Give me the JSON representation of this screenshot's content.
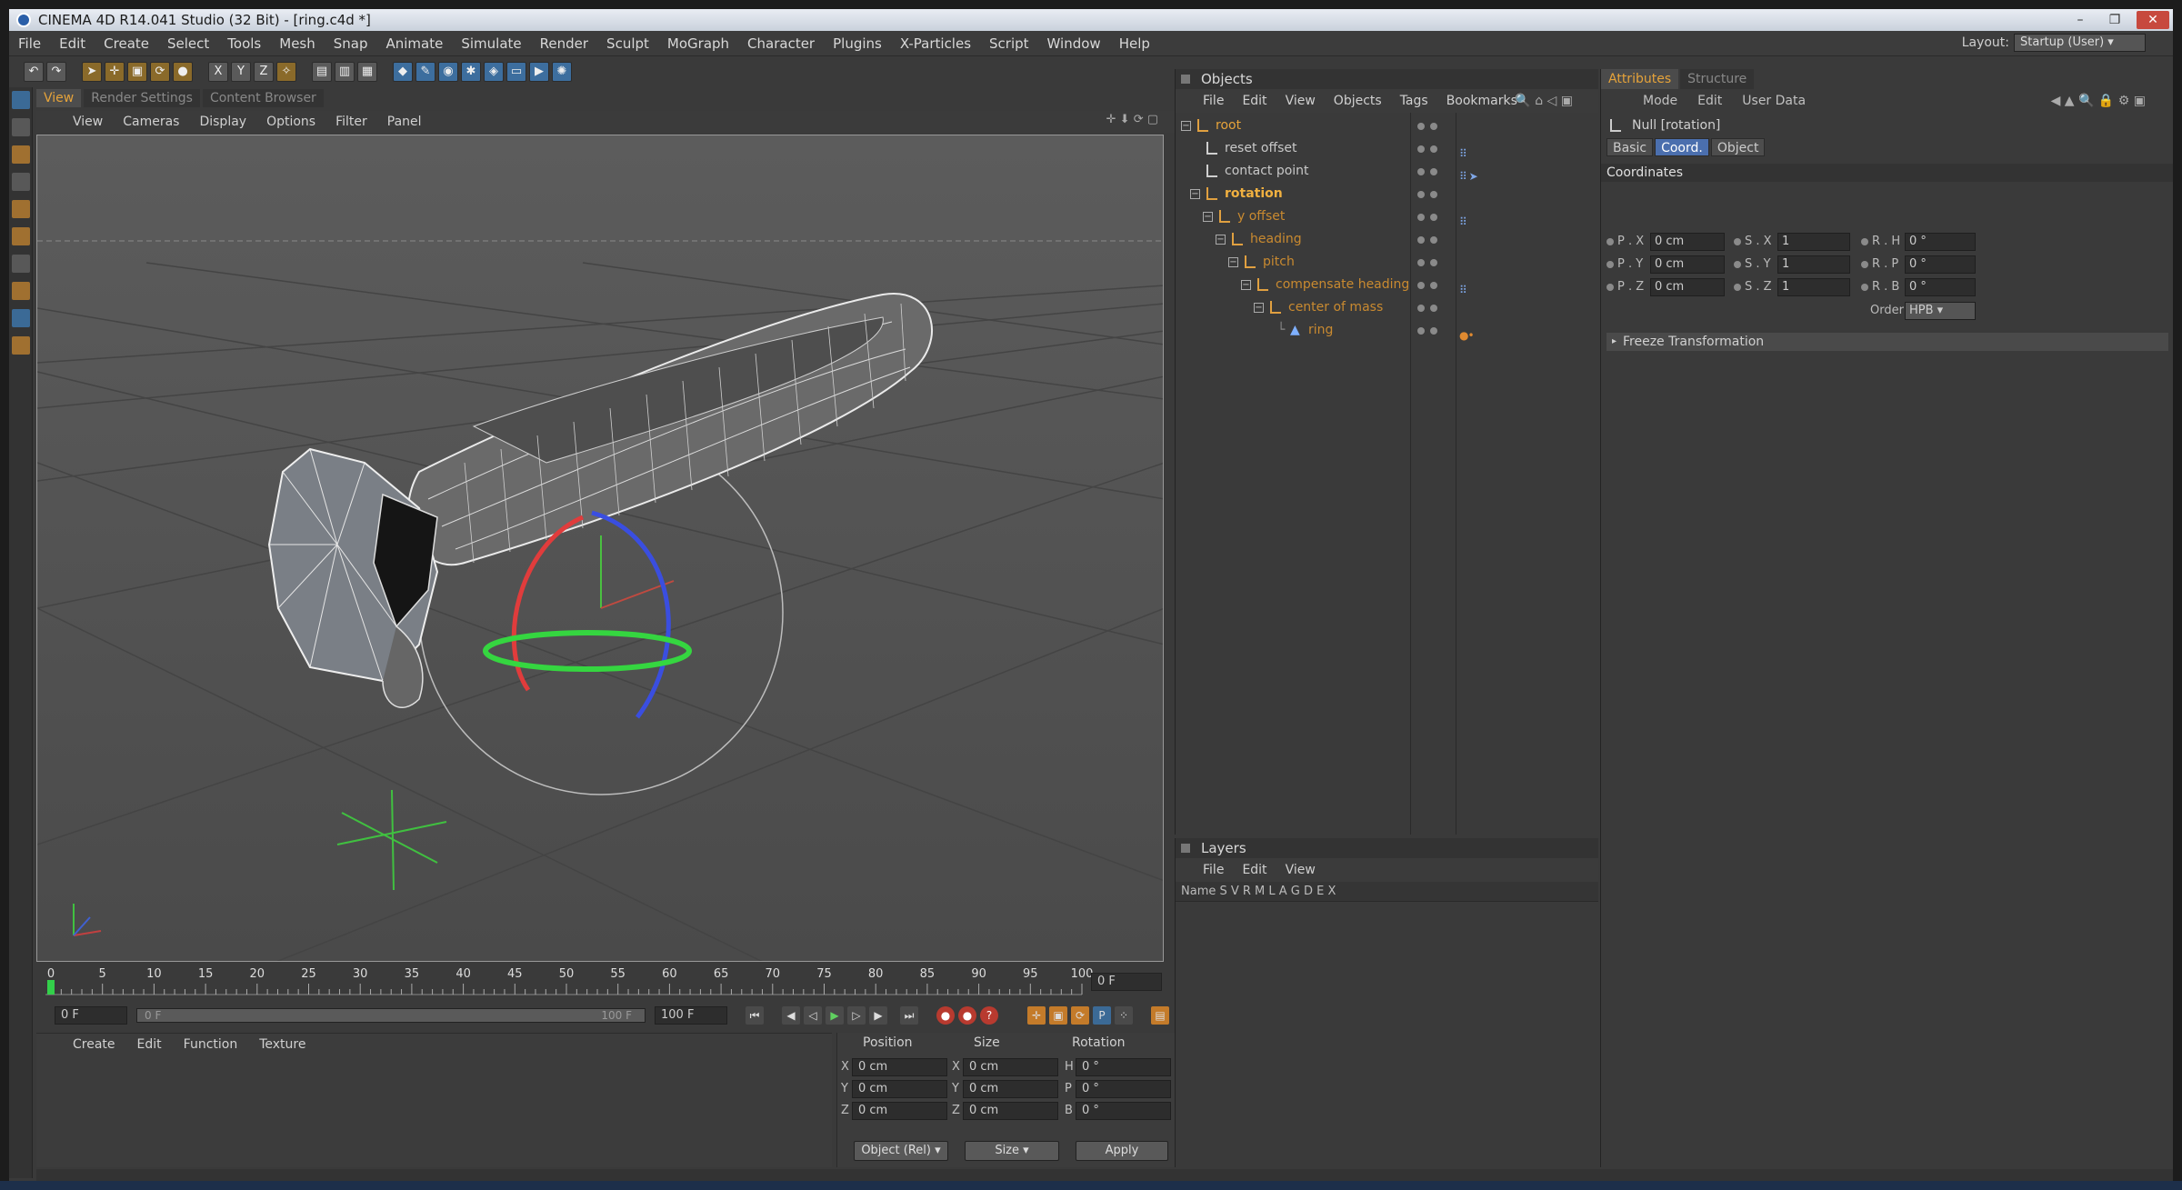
{
  "window": {
    "title": "CINEMA 4D R14.041 Studio (32 Bit) - [ring.c4d *]",
    "controls": [
      "–",
      "❐",
      "✕"
    ]
  },
  "menubar": {
    "items": [
      "File",
      "Edit",
      "Create",
      "Select",
      "Tools",
      "Mesh",
      "Snap",
      "Animate",
      "Simulate",
      "Render",
      "Sculpt",
      "MoGraph",
      "Character",
      "Plugins",
      "X-Particles",
      "Script",
      "Window",
      "Help"
    ],
    "layout_label": "Layout:",
    "layout_value": "Startup (User)"
  },
  "viewport": {
    "tabs": [
      "View",
      "Render Settings",
      "Content Browser"
    ],
    "menu": [
      "View",
      "Cameras",
      "Display",
      "Options",
      "Filter",
      "Panel"
    ]
  },
  "timeline": {
    "ticks": [
      "0",
      "5",
      "10",
      "15",
      "20",
      "25",
      "30",
      "35",
      "40",
      "45",
      "50",
      "55",
      "60",
      "65",
      "70",
      "75",
      "80",
      "85",
      "90",
      "95",
      "100"
    ],
    "current_frame": "0 F",
    "start_field": "0 F",
    "slider_start": "0 F",
    "slider_end": "100 F",
    "end_field": "100 F"
  },
  "material_manager": {
    "menu": [
      "Create",
      "Edit",
      "Function",
      "Texture"
    ]
  },
  "coordinates": {
    "headers": [
      "Position",
      "Size",
      "Rotation"
    ],
    "rows": [
      {
        "axis": "X",
        "pos": "0 cm",
        "size_axis": "X",
        "size": "0 cm",
        "rot_axis": "H",
        "rot": "0 °"
      },
      {
        "axis": "Y",
        "pos": "0 cm",
        "size_axis": "Y",
        "size": "0 cm",
        "rot_axis": "P",
        "rot": "0 °"
      },
      {
        "axis": "Z",
        "pos": "0 cm",
        "size_axis": "Z",
        "size": "0 cm",
        "rot_axis": "B",
        "rot": "0 °"
      }
    ],
    "mode": "Object (Rel)",
    "size_mode": "Size",
    "apply": "Apply"
  },
  "objects": {
    "title": "Objects",
    "menu": [
      "File",
      "Edit",
      "View",
      "Objects",
      "Tags",
      "Bookmarks"
    ],
    "items": [
      {
        "name": "root",
        "highlight": true
      },
      {
        "name": "reset offset",
        "highlight": false
      },
      {
        "name": "contact point",
        "highlight": false
      },
      {
        "name": "rotation",
        "highlight": true
      },
      {
        "name": "y offset",
        "highlight": true
      },
      {
        "name": "heading",
        "highlight": true
      },
      {
        "name": "pitch",
        "highlight": true
      },
      {
        "name": "compensate heading",
        "highlight": true
      },
      {
        "name": "center of mass",
        "highlight": true
      },
      {
        "name": "ring",
        "highlight": true
      }
    ]
  },
  "layers": {
    "title": "Layers",
    "menu": [
      "File",
      "Edit",
      "View"
    ],
    "columns": "Name    S V R M L A G D E X"
  },
  "attributes": {
    "tabs": [
      "Attributes",
      "Structure"
    ],
    "menu": [
      "Mode",
      "Edit",
      "User Data"
    ],
    "object_label": "Null [rotation]",
    "subtabs": [
      "Basic",
      "Coord.",
      "Object"
    ],
    "section": "Coordinates",
    "rows": [
      {
        "p": "P . X",
        "pv": "0 cm",
        "s": "S . X",
        "sv": "1",
        "r": "R . H",
        "rv": "0 °"
      },
      {
        "p": "P . Y",
        "pv": "0 cm",
        "s": "S . Y",
        "sv": "1",
        "r": "R . P",
        "rv": "0 °"
      },
      {
        "p": "P . Z",
        "pv": "0 cm",
        "s": "S . Z",
        "sv": "1",
        "r": "R . B",
        "rv": "0 °"
      }
    ],
    "order_label": "Order",
    "order_value": "HPB",
    "freeze": "Freeze Transformation"
  },
  "colors": {
    "accent": "#e6a33a",
    "selected_tab": "#4b6fae",
    "axis_red": "#e03c3c",
    "axis_green": "#35d640",
    "axis_blue": "#3a4ee0"
  }
}
